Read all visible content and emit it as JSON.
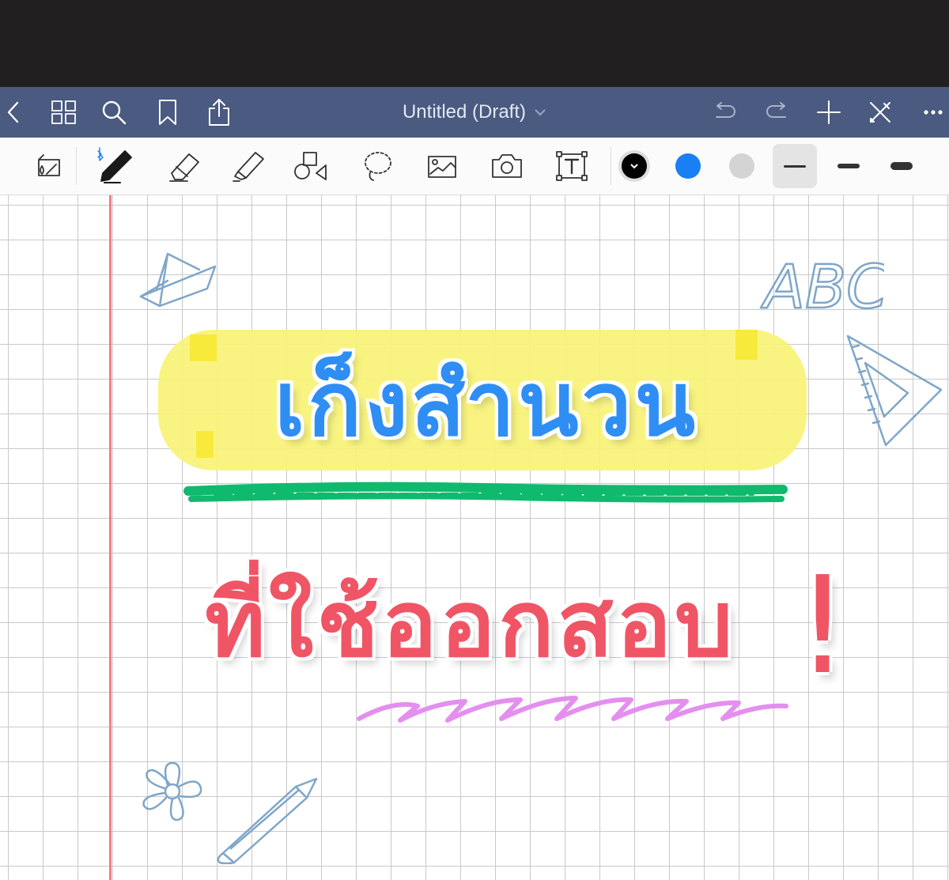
{
  "navbar": {
    "title": "Untitled (Draft)",
    "icons": [
      "back-icon",
      "thumbnails-icon",
      "search-icon",
      "bookmark-icon",
      "share-icon",
      "chevron-down-icon",
      "undo-icon",
      "redo-icon",
      "add-page-icon",
      "close-edit-icon",
      "more-icon"
    ]
  },
  "toolbar": {
    "tools": [
      "read-only-mode",
      "pen",
      "eraser",
      "highlighter",
      "shapes",
      "lasso",
      "image",
      "camera",
      "text"
    ],
    "colors": [
      "#000000",
      "#1a7ef4",
      "#d4d4d4"
    ],
    "stroke_widths": [
      "thin",
      "medium",
      "thick"
    ],
    "selected_width": "thin",
    "active_tool": "pen"
  },
  "canvas": {
    "doodle_text": "ABC",
    "heading_line1": "เก็งสำนวน",
    "heading_line2": "ที่ใช้ออกสอบ",
    "exclamation": "!",
    "colors": {
      "heading1": "#2f8ef3",
      "heading2": "#f05565",
      "highlight": "#f9f377",
      "underline_green": "#0fba6e",
      "zigzag_purple": "#e48fef",
      "doodle": "#7fa6c9",
      "margin_line": "#ef7f84"
    }
  }
}
